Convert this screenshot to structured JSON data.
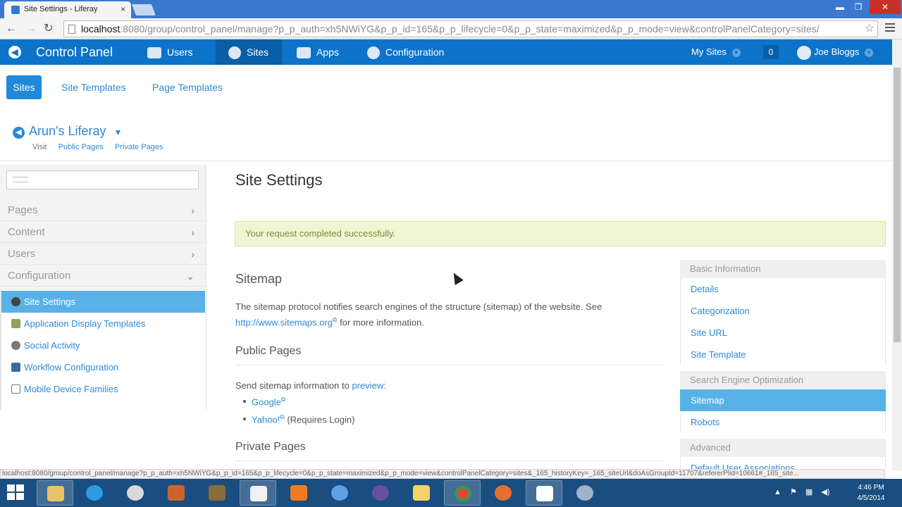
{
  "browser": {
    "tab_title": "Site Settings - Liferay",
    "tab_close": "×",
    "url_host": "localhost",
    "url_rest": ":8080/group/control_panel/manage?p_p_auth=xh5NWiYG&p_p_id=165&p_p_lifecycle=0&p_p_state=maximized&p_p_mode=view&controlPanelCategory=sites/",
    "win_min": "▬",
    "win_max": "❐",
    "win_close": "✕",
    "back": "←",
    "forward": "→",
    "reload": "↻",
    "star": "☆"
  },
  "dockbar": {
    "title": "Control Panel",
    "back_glyph": "◀",
    "items": [
      "Users",
      "Sites",
      "Apps",
      "Configuration"
    ],
    "my_sites": "My Sites",
    "notifications": "0",
    "user": "Joe Bloggs",
    "caret": "▼"
  },
  "subnav": {
    "sites": "Sites",
    "site_templates": "Site Templates",
    "page_templates": "Page Templates"
  },
  "site": {
    "name": "Arun's Liferay",
    "caret": "▼",
    "back_glyph": "◀",
    "visit": "Visit",
    "public_pages": "Public Pages",
    "private_pages": "Private Pages"
  },
  "left_panel": {
    "sections": [
      {
        "label": "Pages",
        "chev": "›"
      },
      {
        "label": "Content",
        "chev": "›"
      },
      {
        "label": "Users",
        "chev": "›"
      },
      {
        "label": "Configuration",
        "chev": "⌄"
      }
    ],
    "items": [
      "Site Settings",
      "Application Display Templates",
      "Social Activity",
      "Workflow Configuration",
      "Mobile Device Families"
    ]
  },
  "main": {
    "title": "Site Settings",
    "alert": "Your request completed successfully.",
    "sitemap_heading": "Sitemap",
    "sitemap_text_1": "The sitemap protocol notifies search engines of the structure (sitemap) of the website. See",
    "sitemap_link": "http://www.sitemaps.org",
    "sitemap_text_2": "for more information.",
    "public_heading": "Public Pages",
    "send_text": "Send sitemap information to",
    "preview_link": "preview:",
    "google": "Google",
    "yahoo": "Yahoo!",
    "yahoo_note": "(Requires Login)",
    "private_heading": "Private Pages",
    "ext_glyph": "⧉"
  },
  "right_nav": {
    "basic_info": "Basic Information",
    "basic_items": [
      "Details",
      "Categorization",
      "Site URL",
      "Site Template"
    ],
    "seo": "Search Engine Optimization",
    "seo_items": [
      "Sitemap",
      "Robots"
    ],
    "advanced": "Advanced",
    "advanced_partial": "Default User Associations"
  },
  "statusbar": {
    "url": "localhost:8080/group/control_panel/manage?p_p_auth=xh5NWiYG&p_p_id=165&p_p_lifecycle=0&p_p_state=maximized&p_p_mode=view&controlPanelCategory=sites&_165_historyKey=_165_siteUrl&doAsGroupId=11707&refererPlid=10661#_165_site..."
  },
  "taskbar": {
    "tray_icons": [
      "▲",
      "⚑",
      "▦",
      "◀)"
    ],
    "time": "4:46 PM",
    "date": "4/5/2014"
  },
  "colors": {
    "dockbar": "#0d73c9",
    "link": "#2e89d6",
    "active_item": "#58b2e8",
    "alert_bg": "#f0f6d4"
  }
}
